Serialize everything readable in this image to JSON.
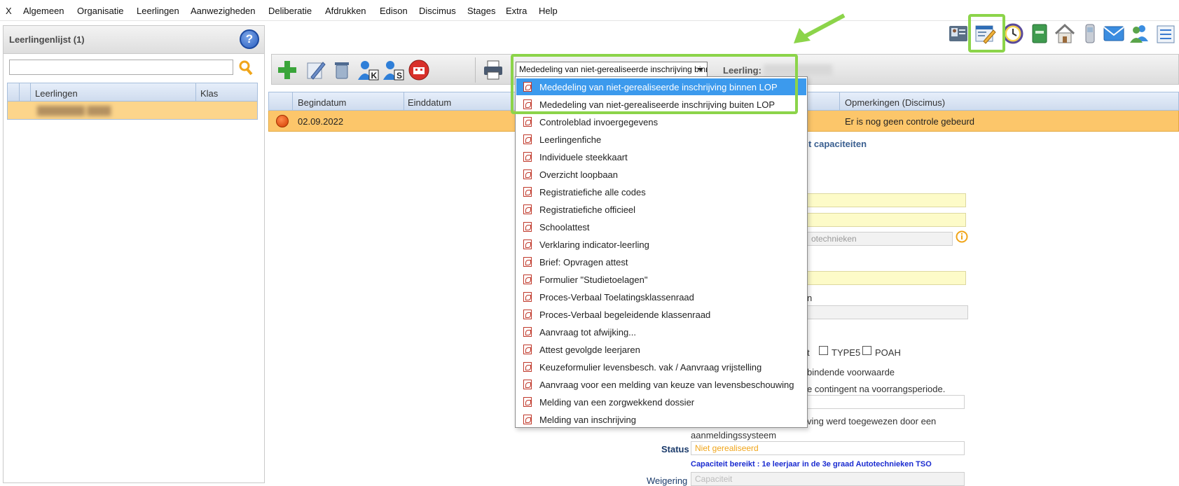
{
  "menu": [
    "X",
    "Algemeen",
    "Organisatie",
    "Leerlingen",
    "Aanwezigheden",
    "Deliberatie",
    "Afdrukken",
    "Edison",
    "Discimus",
    "Stages",
    "Extra",
    "Help"
  ],
  "left_panel": {
    "title": "Leerlingenlijst (1)",
    "help_icon": "?",
    "search_value": "",
    "columns": [
      "Leerlingen",
      "Klas"
    ]
  },
  "toolbar": {
    "icons": [
      "add-icon",
      "edit-icon",
      "delete-icon",
      "user-k-icon",
      "user-s-icon",
      "school-icon",
      "print-icon"
    ],
    "report_selected": "Mededeling van niet-gerealiseerde inschrijving binnen LOP",
    "leerling_label": "Leerling:"
  },
  "table": {
    "columns": [
      "Begindatum",
      "Einddatum",
      "Opmerkingen (Discimus)"
    ],
    "row": {
      "begindatum": "02.09.2022",
      "opmerking": "Er is nog geen controle gebeurd"
    }
  },
  "form": {
    "heading_partial": "ht capaciteiten",
    "field_partial": "otechnieken",
    "label_n": "n",
    "label_t": "t",
    "cb_type5": "TYPE5",
    "cb_poah": "POAH",
    "text_bindend": "bindende voorwaarde",
    "text_contingent": "e contingent na voorrangsperiode.",
    "text_toegewezen": "ving werd toegewezen door een",
    "text_aanmelding": "aanmeldingssysteem",
    "status_label": "Status",
    "status_value": "Niet gerealiseerd",
    "capaciteit_note": "Capaciteit bereikt : 1e leerjaar in de 3e graad Autotechnieken TSO",
    "weigering_label": "Weigering",
    "weigering_value": "Capaciteit"
  },
  "dropdown_items": [
    "Mededeling van niet-gerealiseerde inschrijving binnen LOP",
    "Mededeling van niet-gerealiseerde inschrijving buiten LOP",
    "Controleblad invoergegevens",
    "Leerlingenfiche",
    "Individuele steekkaart",
    "Overzicht loopbaan",
    "Registratiefiche alle codes",
    "Registratiefiche officieel",
    "Schoolattest",
    "Verklaring indicator-leerling",
    "Brief: Opvragen attest",
    "Formulier \"Studietoelagen\"",
    "Proces-Verbaal Toelatingsklassenraad",
    "Proces-Verbaal begeleidende klassenraad",
    "Aanvraag tot afwijking...",
    "Attest gevolgde leerjaren",
    "Keuzeformulier levensbesch. vak / Aanvraag vrijstelling",
    "Aanvraag voor een melding van keuze van levensbeschouwing",
    "Melding van een zorgwekkend dossier",
    "Melding van inschrijving"
  ],
  "top_icons": [
    "id-card-icon",
    "edit-form-icon",
    "clock-icon",
    "notebook-icon",
    "home-icon",
    "phone-icon",
    "mail-icon",
    "users-icon",
    "list-icon"
  ],
  "colors": {
    "highlight": "#8cd44a",
    "row": "#fcc66a",
    "selected": "#3c9aed"
  }
}
